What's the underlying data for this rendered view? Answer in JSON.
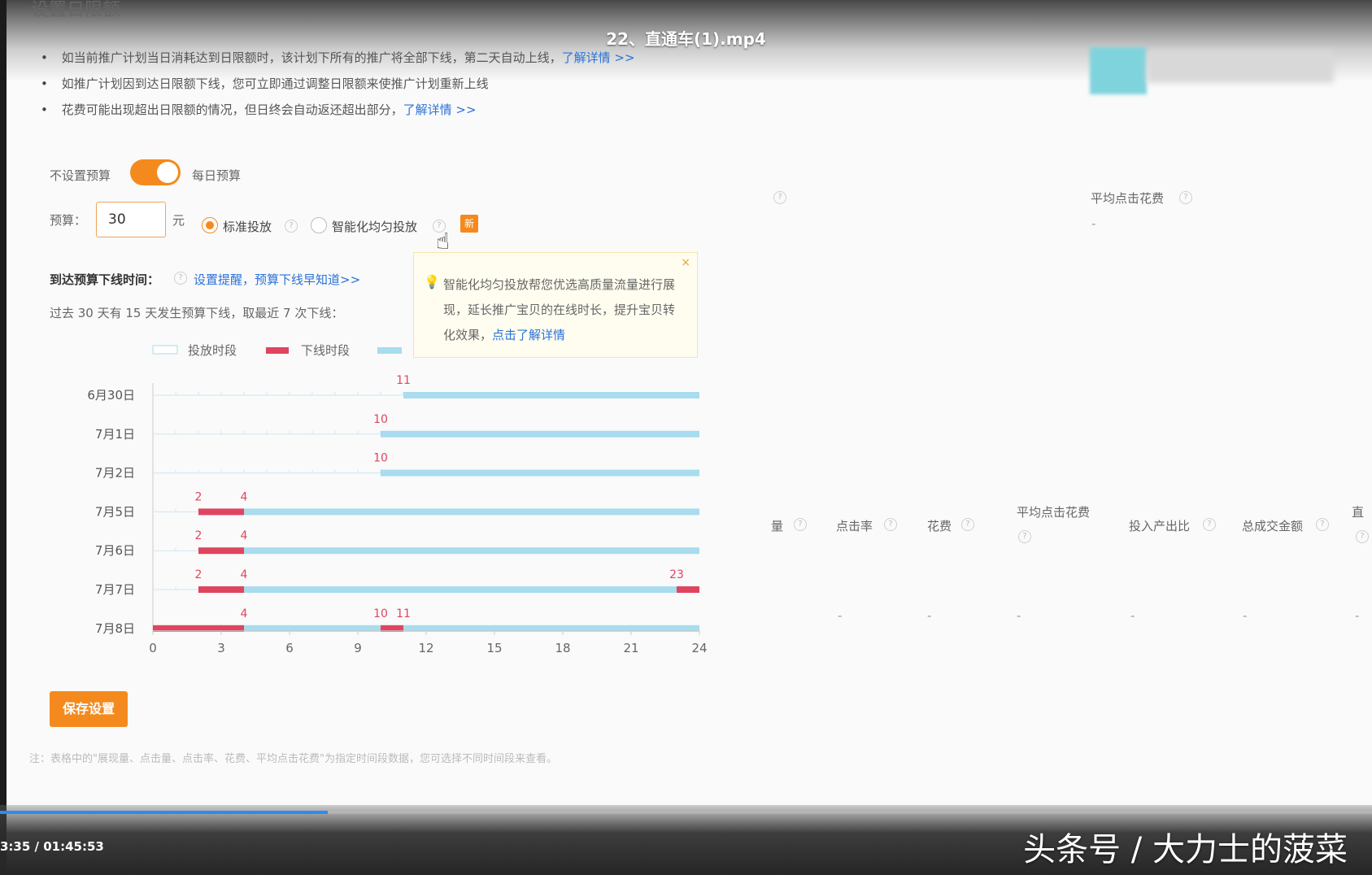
{
  "video": {
    "title": "22、直通车(1).mp4",
    "time": "3:35 / 01:45:53",
    "progress": 0.239,
    "watermark": "头条号 / 大力士的菠菜"
  },
  "section_title": "设置日限额",
  "bullets": [
    {
      "text": "如当前推广计划当日消耗达到日限额时，该计划下所有的推广将全部下线，第二天自动上线，",
      "link": "了解详情 >>"
    },
    {
      "text": "如推广计划因到达日限额下线，您可立即通过调整日限额来使推广计划重新上线",
      "link": ""
    },
    {
      "text": "花费可能出现超出日限额的情况，但日终会自动返还超出部分，",
      "link": "了解详情 >>"
    }
  ],
  "budget": {
    "toggle_left": "不设置预算",
    "toggle_right": "每日预算",
    "toggle_on": true,
    "label": "预算：",
    "value": "30",
    "unit": "元",
    "options": [
      {
        "label": "标准投放",
        "selected": true
      },
      {
        "label": "智能化均匀投放",
        "selected": false
      }
    ],
    "new_badge": "新"
  },
  "tooltip": {
    "text": "智能化均匀投放帮您优选高质量流量进行展现，延长推广宝贝的在线时长，提升宝贝转化效果，",
    "link": "点击了解详情",
    "close": "×"
  },
  "offline": {
    "label": "到达预算下线时间：",
    "link": "设置提醒，预算下线早知道>>",
    "summary": "过去 30 天有 15 天发生预算下线，取最近 7 次下线："
  },
  "chart_data": {
    "type": "timeline",
    "legend": [
      "投放时段",
      "下线时段"
    ],
    "x_ticks": [
      0,
      3,
      6,
      9,
      12,
      15,
      18,
      21,
      24
    ],
    "xlim": [
      0,
      24
    ],
    "colors": {
      "online": "#a8dcee",
      "offline": "#e0455f",
      "label": "#e0455f"
    },
    "rows": [
      {
        "date": "6月30日",
        "offline": [],
        "online": [
          [
            11,
            24
          ]
        ],
        "labels": [
          11
        ]
      },
      {
        "date": "7月1日",
        "offline": [],
        "online": [
          [
            10,
            24
          ]
        ],
        "labels": [
          10
        ]
      },
      {
        "date": "7月2日",
        "offline": [],
        "online": [
          [
            10,
            24
          ]
        ],
        "labels": [
          10
        ]
      },
      {
        "date": "7月5日",
        "offline": [
          [
            2,
            4
          ]
        ],
        "online": [
          [
            4,
            24
          ]
        ],
        "labels": [
          2,
          4
        ]
      },
      {
        "date": "7月6日",
        "offline": [
          [
            2,
            4
          ]
        ],
        "online": [
          [
            4,
            24
          ]
        ],
        "labels": [
          2,
          4
        ]
      },
      {
        "date": "7月7日",
        "offline": [
          [
            2,
            4
          ],
          [
            23,
            24
          ]
        ],
        "online": [
          [
            4,
            23
          ]
        ],
        "labels": [
          2,
          4,
          23
        ]
      },
      {
        "date": "7月8日",
        "offline": [
          [
            0,
            4
          ],
          [
            10,
            11
          ]
        ],
        "online": [
          [
            4,
            10
          ],
          [
            11,
            24
          ]
        ],
        "labels": [
          4,
          10,
          11
        ]
      }
    ]
  },
  "save_button": "保存设置",
  "note": "注：表格中的\"展现量、点击量、点击率、花费、平均点击花费\"为指定时间段数据，您可选择不同时间段来查看。",
  "right_panel": {
    "top_header": "平均点击花费",
    "top_value": "-",
    "headers": [
      "量",
      "点击率",
      "花费",
      "平均点击花费",
      "投入产出比",
      "总成交金额",
      "直"
    ],
    "values": [
      "-",
      "-",
      "-",
      "-",
      "-",
      "-",
      "-"
    ]
  }
}
